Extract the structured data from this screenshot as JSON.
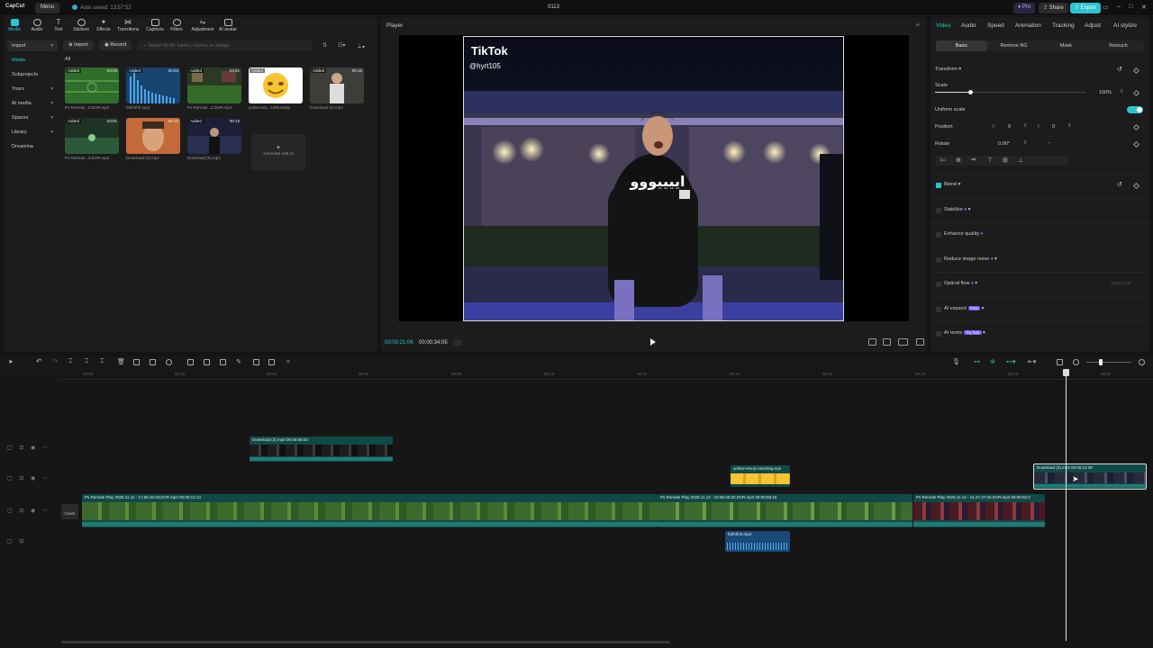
{
  "app": {
    "logo": "CapCut",
    "menu_label": "Menu",
    "autosave": "Auto saved: 13:57:52",
    "project_title": "0113",
    "pro_label": "Pro",
    "share_label": "Share",
    "export_label": "Export"
  },
  "toolbar": {
    "items": [
      "Media",
      "Audio",
      "Text",
      "Stickers",
      "Effects",
      "Transitions",
      "Captions",
      "Filters",
      "Adjustment",
      "AI avatar"
    ]
  },
  "media": {
    "nav": [
      {
        "label": "Import"
      },
      {
        "label": "Media"
      },
      {
        "label": "Subprojects"
      },
      {
        "label": "Yours"
      },
      {
        "label": "AI media"
      },
      {
        "label": "Spaces"
      },
      {
        "label": "Library"
      },
      {
        "label": "Dreamina"
      }
    ],
    "import_label": "Import",
    "record_label": "Record",
    "search_placeholder": "Search for file names, scenes, or dialogs",
    "filter_all": "All",
    "items": [
      {
        "added": "Added",
        "duration": "03:29",
        "caption": "Ps Remote...0.DVR.mp4",
        "color": "#2e6b2a"
      },
      {
        "added": "Added",
        "duration": "00:03",
        "caption": "fahhhhh.mp3",
        "color": "#1d4e7a"
      },
      {
        "added": "Added",
        "duration": "03:01",
        "caption": "Ps Remote...2.DVR.mp4",
        "color": "#3a4a2a"
      },
      {
        "added": "Added",
        "duration": "",
        "caption": "yellow-em...1695.webp",
        "color": "#ffffff"
      },
      {
        "added": "Added",
        "duration": "00:15",
        "caption": "Download (3).mp4",
        "color": "#3a3a3a"
      },
      {
        "added": "Added",
        "duration": "03:01",
        "caption": "Ps Remote...3.DVR.mp4",
        "color": "#24372c"
      },
      {
        "added": "",
        "duration": "00:15",
        "caption": "Download (4).mp4",
        "color": "#c46a3a"
      },
      {
        "added": "Added",
        "duration": "00:13",
        "caption": "Download (5).mp4",
        "color": "#1f2238"
      }
    ],
    "generate_label": "Generate with AI"
  },
  "player": {
    "title": "Player",
    "watermark_brand": "TikTok",
    "watermark_user": "@hyrt105",
    "caption_text": "اييييووو",
    "current_time": "00:00:21:06",
    "total_time": "00:00:34:05"
  },
  "inspector": {
    "tabs": [
      "Video",
      "Audio",
      "Speed",
      "Animation",
      "Tracking",
      "Adjust",
      "AI stylize"
    ],
    "subtabs": [
      "Basic",
      "Remove BG",
      "Mask",
      "Retouch"
    ],
    "transform_label": "Transform",
    "scale_label": "Scale",
    "scale_value": "100%",
    "scale_fraction": 0.23,
    "uniform_scale_label": "Uniform scale",
    "position_label": "Position",
    "pos_x_label": "X",
    "pos_x": "0",
    "pos_y_label": "Y",
    "pos_y": "0",
    "rotate_label": "Rotate",
    "rotate_value": "0.00°",
    "blend_label": "Blend",
    "stabilize_label": "Stabilize",
    "enhance_label": "Enhance quality",
    "reduce_noise_label": "Reduce image noise",
    "optical_flow_label": "Optical flow",
    "ai_expand_label": "AI expand",
    "ai_expand_tag": "Free",
    "ai_remix_label": "AI remix",
    "ai_remix_tag": "Try free",
    "apply_all_label": "Apply to all"
  },
  "timeline": {
    "ruler": [
      "00:00",
      "00:02",
      "00:04",
      "00:06",
      "00:08",
      "00:10",
      "00:12",
      "00:14",
      "00:16",
      "00:18",
      "00:20",
      "00:22"
    ],
    "cover_label": "Cover",
    "clips": {
      "d3": "Download (3).mp4   00:00:05:03",
      "emoji": "yellow-emoji-coverting-eye",
      "d5": "Download (5).mp4   00:00:12:29",
      "main1": "Ps Remote Play 2025.11.11 - 17.55.26.03.DVR.mp4   00:00:12:13",
      "main2": "Ps Remote Play 2025.11.12 - 19.56.05.02.DVR.mp4   00:00:05:15",
      "main3": "Ps Remote Play 2025.11.12 - 21.27.37.03.DVR.mp4   00:00:02:2",
      "audio": "fahhhhh.mp3"
    }
  }
}
